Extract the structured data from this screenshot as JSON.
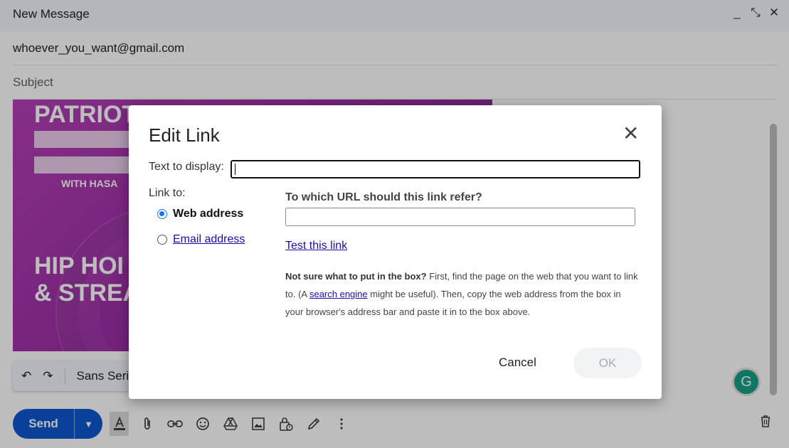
{
  "compose": {
    "title": "New Message",
    "controls": {
      "minimize": "_",
      "exit_fullscreen": "⤡",
      "close": "✕"
    },
    "to": "whoever_you_want@gmail.com",
    "subject_placeholder": "Subject"
  },
  "image": {
    "line1": "PATRIOT",
    "line2": "WITH HASA",
    "line3": "HIP HOI",
    "line4": "& STREA"
  },
  "format_bar": {
    "undo": "↶",
    "redo": "↷",
    "font": "Sans Seri"
  },
  "bottom": {
    "send_label": "Send",
    "send_dropdown": "▼",
    "grammarly": "G"
  },
  "dialog": {
    "title": "Edit Link",
    "close": "✕",
    "text_to_display_label": "Text to display:",
    "text_to_display_value": "",
    "link_to_label": "Link to:",
    "options": [
      "Web address",
      "Email address"
    ],
    "selected_option": "Web address",
    "url_question": "To which URL should this link refer?",
    "url_value": "",
    "test_link": "Test this link",
    "help_bold": "Not sure what to put in the box?",
    "help_part1": " First, find the page on the web that you want to link to. (A ",
    "help_link": "search engine",
    "help_part2": " might be useful). Then, copy the web address from the box in your browser's address bar and paste it in to the box above.",
    "cancel": "Cancel",
    "ok": "OK"
  },
  "colors": {
    "send_blue": "#0b57d0",
    "link_blue": "#1a0dab",
    "radio_blue": "#1a73e8",
    "image_purple": "#9d2ea6"
  }
}
